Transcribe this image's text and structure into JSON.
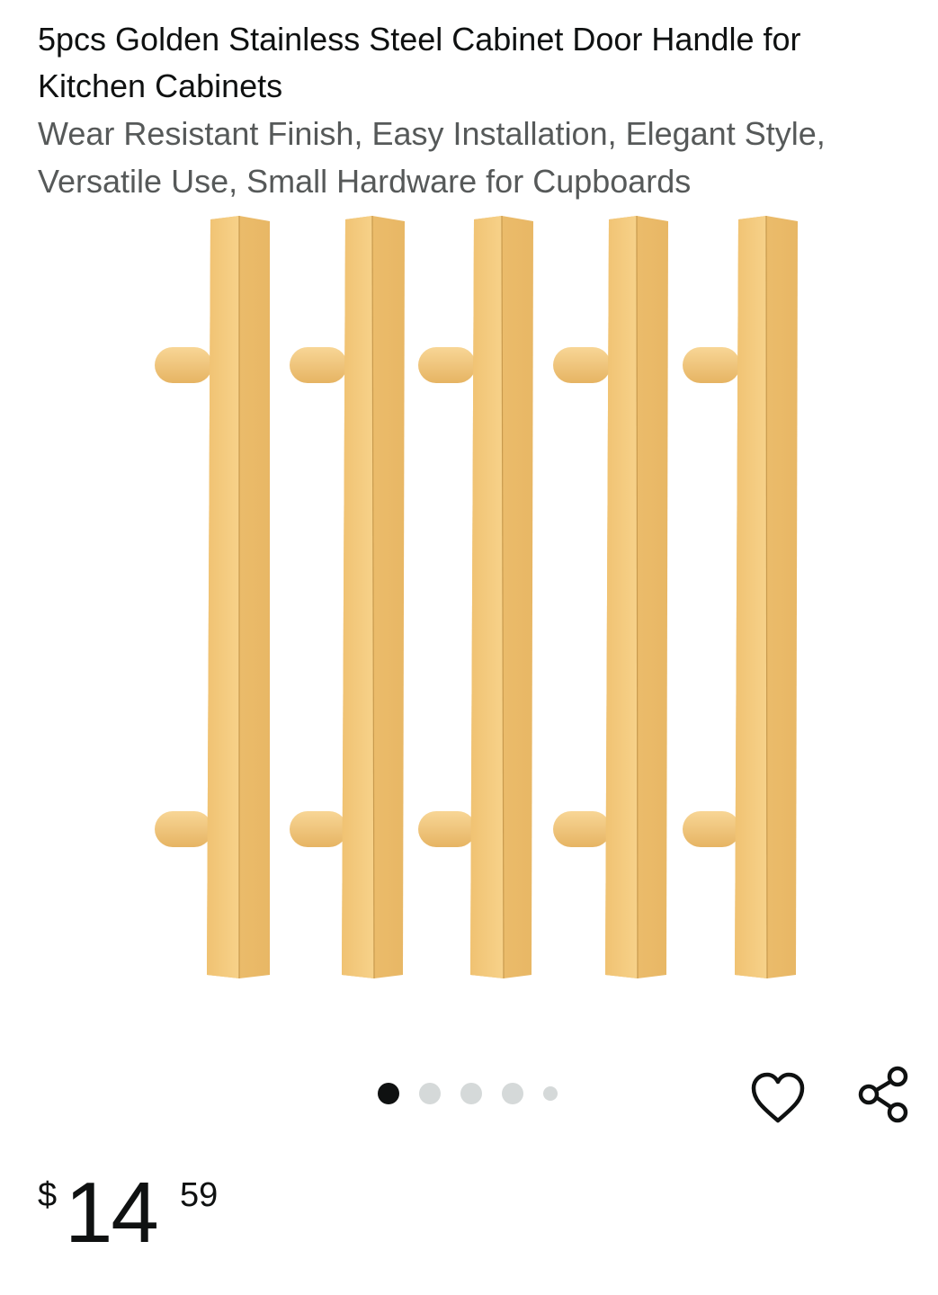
{
  "product": {
    "title": "5pcs Golden Stainless Steel Cabinet Door Handle for Kitchen Cabinets",
    "subtitle": "Wear Resistant Finish, Easy Installation, Elegant Style, Versatile Use, Small Hardware for Cupboards",
    "image_icon": "gold-cabinet-handles-image"
  },
  "carousel": {
    "dot_count": 5,
    "active_index": 0
  },
  "actions": {
    "wishlist_icon": "heart-icon",
    "share_icon": "share-icon"
  },
  "price": {
    "symbol": "$",
    "whole": "14",
    "fraction": "59"
  },
  "colors": {
    "title": "#0f1111",
    "subtitle": "#565959",
    "handle_gold": "#f2c577",
    "dot_inactive": "#d5d9d9",
    "dot_active": "#0f1111"
  }
}
